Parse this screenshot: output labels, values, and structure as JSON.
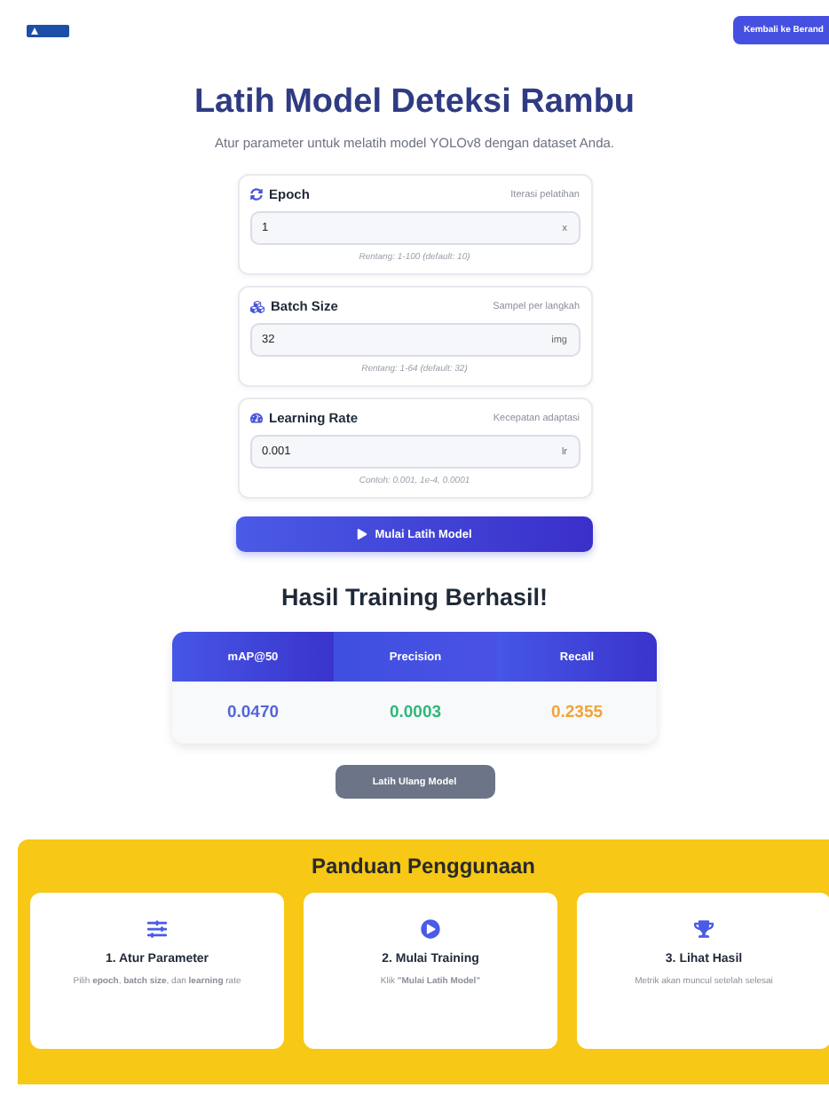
{
  "header": {
    "back_button": "Kembali ke Berand"
  },
  "title": "Latih Model Deteksi Rambu",
  "subtitle": "Atur parameter untuk melatih model YOLOv8 dengan dataset Anda.",
  "params": [
    {
      "kind": "epoch",
      "label": "Epoch",
      "hint": "Iterasi pelatihan",
      "value": "1",
      "unit": "x",
      "note": "Rentang: 1-100 (default: 10)"
    },
    {
      "kind": "batch",
      "label": "Batch Size",
      "hint": "Sampel per langkah",
      "value": "32",
      "unit": "img",
      "note": "Rentang: 1-64 (default: 32)"
    },
    {
      "kind": "lr",
      "label": "Learning Rate",
      "hint": "Kecepatan adaptasi",
      "value": "0.001",
      "unit": "lr",
      "note": "Contoh: 0.001, 1e-4, 0.0001"
    }
  ],
  "start_button": "Mulai Latih Model",
  "results": {
    "title": "Hasil Training Berhasil!",
    "metrics": [
      {
        "label": "mAP@50",
        "value": "0.0470",
        "color": "#5565d8"
      },
      {
        "label": "Precision",
        "value": "0.0003",
        "color": "#2fb87a"
      },
      {
        "label": "Recall",
        "value": "0.2355",
        "color": "#f0a43a"
      }
    ]
  },
  "retrain_button": "Latih Ulang Model",
  "guide": {
    "title": "Panduan Penggunaan",
    "steps": [
      {
        "kind": "sliders",
        "title": "1. Atur Parameter",
        "text": "Pilih **epoch**, **batch size**, dan **learning** rate"
      },
      {
        "kind": "play",
        "title": "2. Mulai Training",
        "text": "Klik **\"Mulai Latih Model\"**"
      },
      {
        "kind": "trophy",
        "title": "3. Lihat Hasil",
        "text": "Metrik akan muncul setelah selesai"
      }
    ]
  }
}
